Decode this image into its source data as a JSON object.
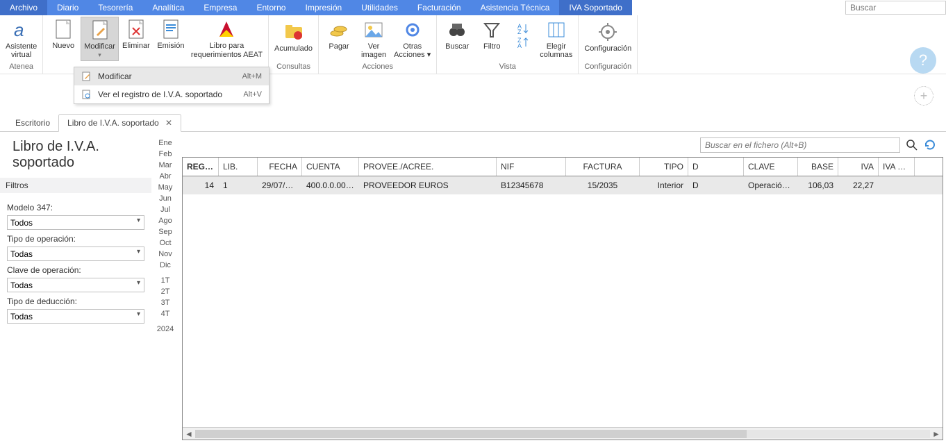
{
  "menubar": {
    "items": [
      "Archivo",
      "Diario",
      "Tesorería",
      "Analítica",
      "Empresa",
      "Entorno",
      "Impresión",
      "Utilidades",
      "Facturación",
      "Asistencia Técnica",
      "IVA Soportado"
    ],
    "active_index": 10,
    "global_search_placeholder": "Buscar"
  },
  "ribbon": {
    "groups": [
      {
        "label": "Atenea",
        "buttons": [
          {
            "label": "Asistente\nvirtual",
            "icon": "alpha-icon"
          }
        ]
      },
      {
        "label": "",
        "buttons": [
          {
            "label": "Nuevo",
            "icon": "page-new-icon"
          },
          {
            "label": "Modificar",
            "icon": "page-edit-icon",
            "pressed": true,
            "has_dropdown": true
          },
          {
            "label": "Eliminar",
            "icon": "page-delete-icon"
          },
          {
            "label": "Emisión",
            "icon": "page-print-icon"
          },
          {
            "label": "Libro para\nrequerimientos AEAT",
            "icon": "aeat-icon"
          }
        ]
      },
      {
        "label": "Consultas",
        "buttons": [
          {
            "label": "Acumulado",
            "icon": "folder-sum-icon"
          }
        ]
      },
      {
        "label": "Acciones",
        "buttons": [
          {
            "label": "Pagar",
            "icon": "coins-icon"
          },
          {
            "label": "Ver\nimagen",
            "icon": "image-icon"
          },
          {
            "label": "Otras\nAcciones",
            "icon": "gear-icon",
            "has_dropdown": true
          }
        ]
      },
      {
        "label": "Vista",
        "buttons": [
          {
            "label": "Buscar",
            "icon": "binoculars-icon"
          },
          {
            "label": "Filtro",
            "icon": "funnel-icon"
          },
          {
            "label": "",
            "icon": "sort-az-icon",
            "stacked": true
          },
          {
            "label": "Elegir\ncolumnas",
            "icon": "columns-icon"
          }
        ]
      },
      {
        "label": "Configuración",
        "buttons": [
          {
            "label": "Configuración",
            "icon": "settings-icon"
          }
        ]
      }
    ],
    "dropdown": {
      "items": [
        {
          "label": "Modificar",
          "shortcut": "Alt+M",
          "icon": "page-edit-icon"
        },
        {
          "label": "Ver el registro de I.V.A. soportado",
          "shortcut": "Alt+V",
          "icon": "page-view-icon"
        }
      ]
    }
  },
  "doc_tabs": {
    "items": [
      {
        "label": "Escritorio",
        "closable": false,
        "active": false
      },
      {
        "label": "Libro de I.V.A. soportado",
        "closable": true,
        "active": true
      }
    ]
  },
  "page": {
    "title": "Libro de I.V.A. soportado",
    "file_search_placeholder": "Buscar en el fichero (Alt+B)"
  },
  "filters": {
    "header": "Filtros",
    "fields": [
      {
        "label": "Modelo 347:",
        "value": "Todos"
      },
      {
        "label": "Tipo de operación:",
        "value": "Todas"
      },
      {
        "label": "Clave de operación:",
        "value": "Todas"
      },
      {
        "label": "Tipo de deducción:",
        "value": "Todas"
      }
    ]
  },
  "month_strip": [
    "Ene",
    "Feb",
    "Mar",
    "Abr",
    "May",
    "Jun",
    "Jul",
    "Ago",
    "Sep",
    "Oct",
    "Nov",
    "Dic",
    "1T",
    "2T",
    "3T",
    "4T",
    "2024"
  ],
  "grid": {
    "columns": [
      "REGIS...",
      "LIB.",
      "FECHA",
      "CUENTA",
      "PROVEE./ACREE.",
      "NIF",
      "FACTURA",
      "TIPO",
      "D",
      "CLAVE",
      "BASE",
      "IVA",
      "IVA DED"
    ],
    "rows": [
      {
        "regis": "14",
        "lib": "1",
        "fecha": "29/07/20...",
        "cuenta": "400.0.0.00000",
        "provee": "PROVEEDOR EUROS",
        "nif": "B12345678",
        "factura": "15/2035",
        "tipo": "Interior",
        "d": "D",
        "clave": "Operación ...",
        "base": "106,03",
        "iva": "22,27",
        "ivaded": ""
      }
    ]
  }
}
